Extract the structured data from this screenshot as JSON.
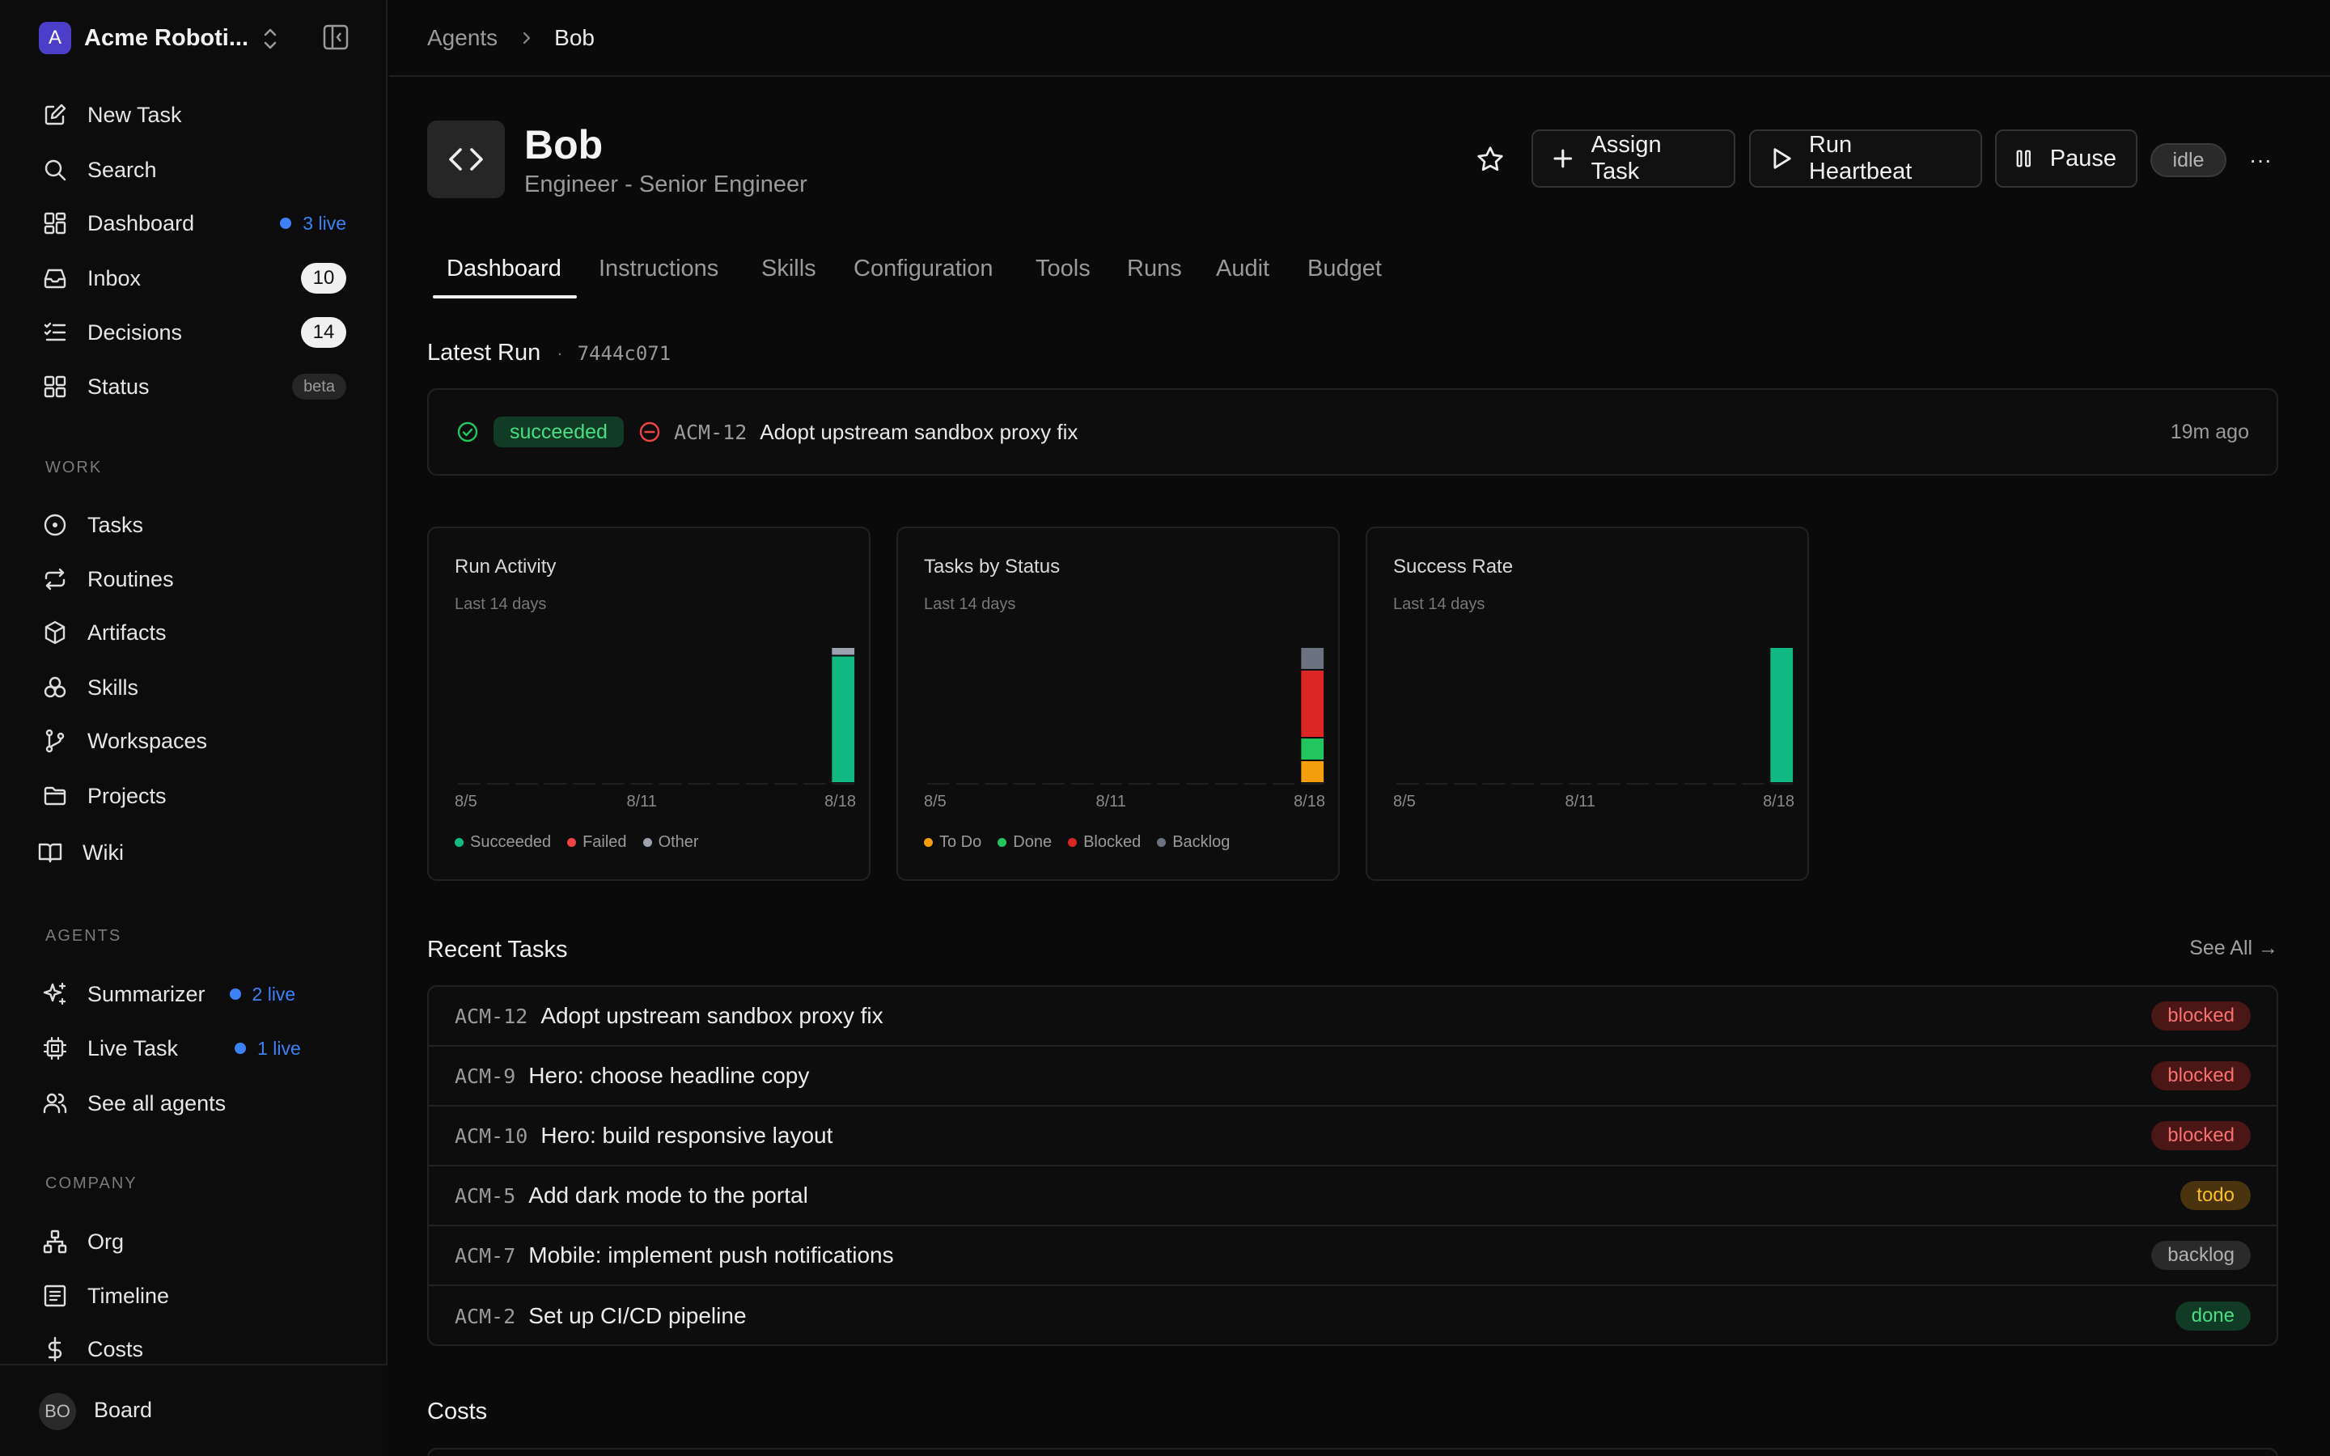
{
  "sidebar": {
    "workspace": {
      "logo_letter": "A",
      "name": "Acme Roboti..."
    },
    "nav": [
      {
        "label": "New Task",
        "icon": "edit-icon"
      },
      {
        "label": "Search",
        "icon": "search-icon"
      },
      {
        "label": "Dashboard",
        "icon": "dashboard-icon",
        "live": "3 live"
      },
      {
        "label": "Inbox",
        "icon": "inbox-icon",
        "count": "10"
      },
      {
        "label": "Decisions",
        "icon": "checklist-icon",
        "count": "14"
      },
      {
        "label": "Status",
        "icon": "grid-icon",
        "tag": "beta"
      }
    ],
    "work_label": "WORK",
    "work": [
      {
        "label": "Tasks",
        "icon": "circle-dot-icon"
      },
      {
        "label": "Routines",
        "icon": "repeat-icon"
      },
      {
        "label": "Artifacts",
        "icon": "cube-icon"
      },
      {
        "label": "Skills",
        "icon": "skills-icon"
      },
      {
        "label": "Workspaces",
        "icon": "git-branch-icon"
      },
      {
        "label": "Projects",
        "icon": "folder-icon"
      },
      {
        "label": "Wiki",
        "icon": "book-icon"
      }
    ],
    "agents_label": "AGENTS",
    "agents": [
      {
        "label": "Summarizer",
        "icon": "sparkle-icon",
        "live": "2 live"
      },
      {
        "label": "Live Task",
        "icon": "cpu-icon",
        "live": "1 live"
      },
      {
        "label": "See all agents",
        "icon": "users-icon"
      }
    ],
    "company_label": "COMPANY",
    "company": [
      {
        "label": "Org",
        "icon": "org-icon"
      },
      {
        "label": "Timeline",
        "icon": "timeline-icon"
      },
      {
        "label": "Costs",
        "icon": "dollar-icon"
      }
    ],
    "footer": {
      "initials": "BO",
      "label": "Board"
    }
  },
  "breadcrumb": {
    "parent": "Agents",
    "current": "Bob"
  },
  "agent": {
    "name": "Bob",
    "role": "Engineer - Senior Engineer",
    "status": "idle"
  },
  "actions": {
    "assign": "Assign Task",
    "heartbeat": "Run Heartbeat",
    "pause": "Pause",
    "more": "···"
  },
  "tabs": [
    "Dashboard",
    "Instructions",
    "Skills",
    "Configuration",
    "Tools",
    "Runs",
    "Audit",
    "Budget"
  ],
  "latest_run": {
    "title": "Latest Run",
    "sep": "·",
    "run_id": "7444c071",
    "status": "succeeded",
    "task_id": "ACM-12",
    "task_title": "Adopt upstream sandbox proxy fix",
    "time": "19m ago"
  },
  "charts": {
    "run_activity": {
      "title": "Run Activity",
      "subtitle": "Last 14 days",
      "x_labels": [
        "8/5",
        "8/11",
        "8/18"
      ],
      "legend": [
        "Succeeded",
        "Failed",
        "Other"
      ]
    },
    "tasks_by_status": {
      "title": "Tasks by Status",
      "subtitle": "Last 14 days",
      "x_labels": [
        "8/5",
        "8/11",
        "8/18"
      ],
      "legend": [
        "To Do",
        "Done",
        "Blocked",
        "Backlog"
      ]
    },
    "success_rate": {
      "title": "Success Rate",
      "subtitle": "Last 14 days",
      "x_labels": [
        "8/5",
        "8/11",
        "8/18"
      ]
    }
  },
  "chart_data": [
    {
      "type": "bar",
      "title": "Run Activity",
      "subtitle": "Last 14 days",
      "categories": [
        "8/5",
        "8/6",
        "8/7",
        "8/8",
        "8/9",
        "8/10",
        "8/11",
        "8/12",
        "8/13",
        "8/14",
        "8/15",
        "8/16",
        "8/17",
        "8/18"
      ],
      "tick_labels": [
        "8/5",
        "8/11",
        "8/18"
      ],
      "stacked": true,
      "series": [
        {
          "name": "Succeeded",
          "color": "#10b981",
          "values": [
            0,
            0,
            0,
            0,
            0,
            0,
            0,
            0,
            0,
            0,
            0,
            0,
            0,
            15
          ]
        },
        {
          "name": "Failed",
          "color": "#ef4444",
          "values": [
            0,
            0,
            0,
            0,
            0,
            0,
            0,
            0,
            0,
            0,
            0,
            0,
            0,
            0
          ]
        },
        {
          "name": "Other",
          "color": "#9ca3af",
          "values": [
            0,
            0,
            0,
            0,
            0,
            0,
            0,
            0,
            0,
            0,
            0,
            0,
            0,
            1
          ]
        }
      ]
    },
    {
      "type": "bar",
      "title": "Tasks by Status",
      "subtitle": "Last 14 days",
      "categories": [
        "8/5",
        "8/6",
        "8/7",
        "8/8",
        "8/9",
        "8/10",
        "8/11",
        "8/12",
        "8/13",
        "8/14",
        "8/15",
        "8/16",
        "8/17",
        "8/18"
      ],
      "tick_labels": [
        "8/5",
        "8/11",
        "8/18"
      ],
      "stacked": true,
      "series": [
        {
          "name": "To Do",
          "color": "#f59e0b",
          "values": [
            0,
            0,
            0,
            0,
            0,
            0,
            0,
            0,
            0,
            0,
            0,
            0,
            0,
            1
          ]
        },
        {
          "name": "Done",
          "color": "#22c55e",
          "values": [
            0,
            0,
            0,
            0,
            0,
            0,
            0,
            0,
            0,
            0,
            0,
            0,
            0,
            1
          ]
        },
        {
          "name": "Blocked",
          "color": "#dc2626",
          "values": [
            0,
            0,
            0,
            0,
            0,
            0,
            0,
            0,
            0,
            0,
            0,
            0,
            0,
            3
          ]
        },
        {
          "name": "Backlog",
          "color": "#6b7280",
          "values": [
            0,
            0,
            0,
            0,
            0,
            0,
            0,
            0,
            0,
            0,
            0,
            0,
            0,
            1
          ]
        }
      ]
    },
    {
      "type": "bar",
      "title": "Success Rate",
      "subtitle": "Last 14 days",
      "categories": [
        "8/5",
        "8/6",
        "8/7",
        "8/8",
        "8/9",
        "8/10",
        "8/11",
        "8/12",
        "8/13",
        "8/14",
        "8/15",
        "8/16",
        "8/17",
        "8/18"
      ],
      "tick_labels": [
        "8/5",
        "8/11",
        "8/18"
      ],
      "series": [
        {
          "color": "#10b981",
          "values": [
            0,
            0,
            0,
            0,
            0,
            0,
            0,
            0,
            0,
            0,
            0,
            0,
            0,
            100
          ]
        }
      ],
      "ylim": [
        0,
        100
      ]
    }
  ],
  "recent_tasks": {
    "title": "Recent Tasks",
    "see_all": "See All →",
    "rows": [
      {
        "id": "ACM-12",
        "title": "Adopt upstream sandbox proxy fix",
        "status": "blocked"
      },
      {
        "id": "ACM-9",
        "title": "Hero: choose headline copy",
        "status": "blocked"
      },
      {
        "id": "ACM-10",
        "title": "Hero: build responsive layout",
        "status": "blocked"
      },
      {
        "id": "ACM-5",
        "title": "Add dark mode to the portal",
        "status": "todo"
      },
      {
        "id": "ACM-7",
        "title": "Mobile: implement push notifications",
        "status": "backlog"
      },
      {
        "id": "ACM-2",
        "title": "Set up CI/CD pipeline",
        "status": "done"
      }
    ]
  },
  "costs": {
    "title": "Costs"
  }
}
